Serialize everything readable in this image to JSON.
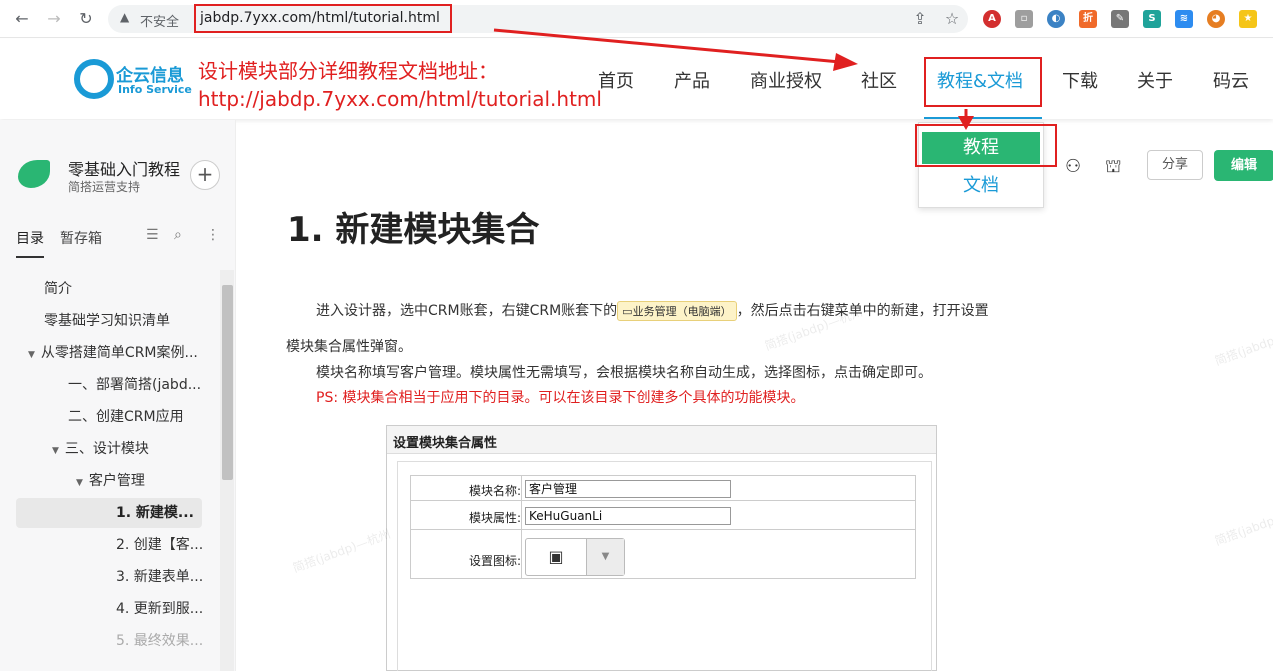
{
  "browser": {
    "security_label": "不安全",
    "url": "jabdp.7yxx.com/html/tutorial.html"
  },
  "site": {
    "logo_text": "企云信息",
    "logo_sub": "Info Service",
    "annotation_line1": "设计模块部分详细教程文档地址：",
    "annotation_line2": "http://jabdp.7yxx.com/html/tutorial.html",
    "menu": [
      {
        "label": "首页"
      },
      {
        "label": "产品"
      },
      {
        "label": "商业授权"
      },
      {
        "label": "社区"
      },
      {
        "label": "教程&文档"
      },
      {
        "label": "下载"
      },
      {
        "label": "关于"
      },
      {
        "label": "码云"
      }
    ],
    "dropdown": {
      "tutorial": "教程",
      "docs": "文档"
    }
  },
  "sidebar": {
    "book_title": "零基础入门教程",
    "book_sub": "简搭运营支持",
    "plus": "+",
    "tab_toc": "目录",
    "tab_drafts": "暂存箱",
    "toc": [
      {
        "label": "简介"
      },
      {
        "label": "零基础学习知识清单"
      },
      {
        "label": "从零搭建简单CRM案例..."
      },
      {
        "label": "一、部署简搭(jabd..."
      },
      {
        "label": "二、创建CRM应用"
      },
      {
        "label": "三、设计模块"
      },
      {
        "label": "客户管理"
      },
      {
        "label": "1. 新建模..."
      },
      {
        "label": "2. 创建【客..."
      },
      {
        "label": "3. 新建表单..."
      },
      {
        "label": "4. 更新到服..."
      },
      {
        "label": "5. 最终效果..."
      }
    ]
  },
  "content": {
    "share_label": "分享",
    "edit_label": "编辑",
    "title": "1. 新建模块集合",
    "para1_a": "进入设计器，选中CRM账套，右键CRM账套下的",
    "para1_tag": "业务管理（电脑端）",
    "para1_b": "，然后点击右键菜单中的新建，打开设置",
    "para1_c": "模块集合属性弹窗。",
    "para2": "模块名称填写客户管理。模块属性无需填写，会根据模块名称自动生成，选择图标，点击确定即可。",
    "para3": "PS: 模块集合相当于应用下的目录。可以在该目录下创建多个具体的功能模块。",
    "watermark": "简搭(jabdp)—杭州"
  },
  "dialog": {
    "title": "设置模块集合属性",
    "name_label": "模块名称:",
    "name_value": "客户管理",
    "attr_label": "模块属性:",
    "attr_value": "KeHuGuanLi",
    "icon_label": "设置图标:"
  },
  "colors": {
    "accent": "#1a9ad6",
    "green": "#2ab673",
    "annotation_red": "#e02020"
  }
}
